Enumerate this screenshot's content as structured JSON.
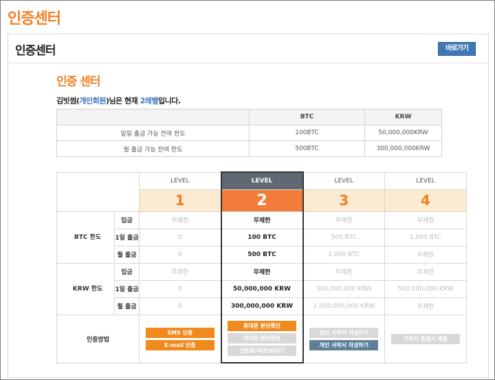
{
  "page": {
    "title": "인증센터"
  },
  "panel": {
    "title": "인증센터",
    "shortcut_label": "바로가기"
  },
  "section": {
    "title": "인증 센터"
  },
  "status": {
    "user": "김빗썸",
    "member_type": "개인회원",
    "mid": "님은 현재 ",
    "level": "2레벨",
    "end": "입니다."
  },
  "limits": {
    "headers": [
      "",
      "BTC",
      "KRW"
    ],
    "rows": [
      {
        "label": "일일 출금 가능 잔여 한도",
        "btc": "100BTC",
        "krw": "50,000,000KRW"
      },
      {
        "label": "월 출금 가능 잔여 한도",
        "btc": "500BTC",
        "krw": "300,000,000KRW"
      }
    ]
  },
  "levels": {
    "level_label": "LEVEL",
    "numbers": [
      "1",
      "2",
      "3",
      "4"
    ],
    "btc_section": "BTC 한도",
    "krw_section": "KRW 한도",
    "btc_rows": [
      {
        "label": "입금",
        "values": [
          "무제한",
          "무제한",
          "무제한",
          "무제한"
        ]
      },
      {
        "label": "1일 출금",
        "values": [
          "0",
          "100 BTC",
          "500 BTC",
          "1,000 BTC"
        ]
      },
      {
        "label": "월 출금",
        "values": [
          "0",
          "500 BTC",
          "2,000 BTC",
          "무제한"
        ]
      }
    ],
    "krw_rows": [
      {
        "label": "입금",
        "values": [
          "무제한",
          "무제한",
          "무제한",
          "무제한"
        ]
      },
      {
        "label": "1일 출금",
        "values": [
          "0",
          "50,000,000 KRW",
          "300,000,000 KRW",
          "500,000,000 KRW"
        ]
      },
      {
        "label": "월 출금",
        "values": [
          "0",
          "300,000,000 KRW",
          "1,000,000,000 KRW",
          "무제한"
        ]
      }
    ],
    "auth_label": "인증방법",
    "auth": {
      "l1": [
        "SMS 인증",
        "E-mail 인증"
      ],
      "l2": [
        "휴대폰 본인확인",
        "아이핀 본인확인",
        "신분증(여권)보내기"
      ],
      "l3": [
        "법인 서약서 작성하기",
        "개인 서약서 작성하기"
      ],
      "l4": [
        "거주지 증명서 제출"
      ]
    }
  }
}
